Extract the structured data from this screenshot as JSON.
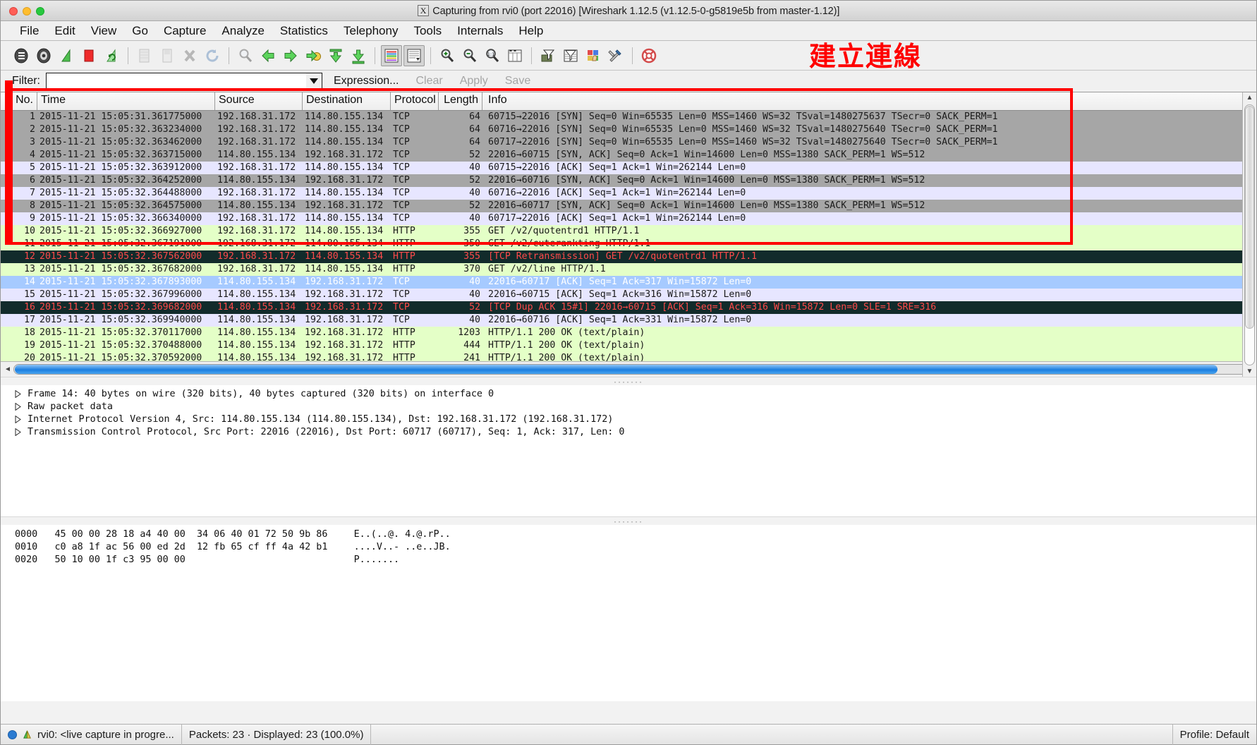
{
  "window": {
    "title_icon": "X",
    "title": "Capturing from rvi0 (port 22016)    [Wireshark 1.12.5  (v1.12.5-0-g5819e5b from master-1.12)]",
    "traffic_lights": [
      "close",
      "minimize",
      "zoom"
    ]
  },
  "menubar": {
    "items": [
      {
        "label": "File",
        "accel": "F"
      },
      {
        "label": "Edit",
        "accel": "E"
      },
      {
        "label": "View",
        "accel": "V"
      },
      {
        "label": "Go",
        "accel": "G"
      },
      {
        "label": "Capture",
        "accel": "C"
      },
      {
        "label": "Analyze",
        "accel": "A"
      },
      {
        "label": "Statistics",
        "accel": "S"
      },
      {
        "label": "Telephony",
        "accel": "y"
      },
      {
        "label": "Tools",
        "accel": "T"
      },
      {
        "label": "Internals",
        "accel": "I"
      },
      {
        "label": "Help",
        "accel": "H"
      }
    ]
  },
  "toolbar": {
    "buttons": [
      {
        "name": "interfaces-icon",
        "tip": "List the available capture interfaces"
      },
      {
        "name": "capture-options-icon",
        "tip": "Show the capture options"
      },
      {
        "name": "start-capture-icon",
        "tip": "Start a new live capture"
      },
      {
        "name": "stop-capture-icon",
        "tip": "Stop the running live capture"
      },
      {
        "name": "restart-capture-icon",
        "tip": "Restart the running live capture"
      },
      {
        "name": "open-file-icon",
        "tip": "Open a capture file"
      },
      {
        "name": "save-file-icon",
        "tip": "Save this capture file"
      },
      {
        "name": "close-file-icon",
        "tip": "Close this capture file"
      },
      {
        "name": "reload-file-icon",
        "tip": "Reload this capture file"
      },
      {
        "name": "find-packet-icon",
        "tip": "Find a packet"
      },
      {
        "name": "go-back-icon",
        "tip": "Go back in packet history"
      },
      {
        "name": "go-forward-icon",
        "tip": "Go forward in packet history"
      },
      {
        "name": "go-to-packet-icon",
        "tip": "Go to the packet with number"
      },
      {
        "name": "go-first-packet-icon",
        "tip": "Go to the first packet"
      },
      {
        "name": "go-last-packet-icon",
        "tip": "Go to the last packet"
      },
      {
        "name": "colorize-icon",
        "tip": "Colorize packet list"
      },
      {
        "name": "autoscroll-icon",
        "tip": "Auto scroll packet list in live capture"
      },
      {
        "name": "zoom-in-icon",
        "tip": "Zoom in"
      },
      {
        "name": "zoom-out-icon",
        "tip": "Zoom out"
      },
      {
        "name": "zoom-reset-icon",
        "tip": "Zoom 1:1"
      },
      {
        "name": "resize-columns-icon",
        "tip": "Resize columns"
      },
      {
        "name": "capture-filters-icon",
        "tip": "Edit capture filters"
      },
      {
        "name": "display-filters-icon",
        "tip": "Edit display filters"
      },
      {
        "name": "coloring-rules-icon",
        "tip": "Edit coloring rules"
      },
      {
        "name": "preferences-icon",
        "tip": "Edit preferences"
      },
      {
        "name": "help-icon",
        "tip": "Show help"
      }
    ]
  },
  "filter": {
    "label": "Filter:",
    "value": "",
    "placeholder": "",
    "expression_label": "Expression...",
    "clear_label": "Clear",
    "apply_label": "Apply",
    "save_label": "Save"
  },
  "annotation": {
    "text": "建立連線",
    "color": "#ff0000"
  },
  "packet_list": {
    "columns": [
      "No.",
      "Time",
      "Source",
      "Destination",
      "Protocol",
      "Length",
      "Info"
    ],
    "rows": [
      {
        "no": "1",
        "time": "2015-11-21 15:05:31.361775000",
        "src": "192.168.31.172",
        "dst": "114.80.155.134",
        "proto": "TCP",
        "len": "64",
        "info": "60715→22016 [SYN]  Seq=0 Win=65535 Len=0 MSS=1460 WS=32 TSval=1480275637 TSecr=0 SACK_PERM=1",
        "style": "r-tcp"
      },
      {
        "no": "2",
        "time": "2015-11-21 15:05:32.363234000",
        "src": "192.168.31.172",
        "dst": "114.80.155.134",
        "proto": "TCP",
        "len": "64",
        "info": "60716→22016 [SYN]  Seq=0 Win=65535 Len=0 MSS=1460 WS=32 TSval=1480275640 TSecr=0 SACK_PERM=1",
        "style": "r-tcp"
      },
      {
        "no": "3",
        "time": "2015-11-21 15:05:32.363462000",
        "src": "192.168.31.172",
        "dst": "114.80.155.134",
        "proto": "TCP",
        "len": "64",
        "info": "60717→22016 [SYN]  Seq=0 Win=65535 Len=0 MSS=1460 WS=32 TSval=1480275640 TSecr=0 SACK_PERM=1",
        "style": "r-tcp"
      },
      {
        "no": "4",
        "time": "2015-11-21 15:05:32.363715000",
        "src": "114.80.155.134",
        "dst": "192.168.31.172",
        "proto": "TCP",
        "len": "52",
        "info": "22016→60715 [SYN, ACK]  Seq=0 Ack=1 Win=14600 Len=0 MSS=1380 SACK_PERM=1 WS=512",
        "style": "r-tcp"
      },
      {
        "no": "5",
        "time": "2015-11-21 15:05:32.363912000",
        "src": "192.168.31.172",
        "dst": "114.80.155.134",
        "proto": "TCP",
        "len": "40",
        "info": "60715→22016 [ACK]  Seq=1 Ack=1 Win=262144 Len=0",
        "style": "r-ack"
      },
      {
        "no": "6",
        "time": "2015-11-21 15:05:32.364252000",
        "src": "114.80.155.134",
        "dst": "192.168.31.172",
        "proto": "TCP",
        "len": "52",
        "info": "22016→60716 [SYN, ACK]  Seq=0 Ack=1 Win=14600 Len=0 MSS=1380 SACK_PERM=1 WS=512",
        "style": "r-tcp"
      },
      {
        "no": "7",
        "time": "2015-11-21 15:05:32.364488000",
        "src": "192.168.31.172",
        "dst": "114.80.155.134",
        "proto": "TCP",
        "len": "40",
        "info": "60716→22016 [ACK]  Seq=1 Ack=1 Win=262144 Len=0",
        "style": "r-ack"
      },
      {
        "no": "8",
        "time": "2015-11-21 15:05:32.364575000",
        "src": "114.80.155.134",
        "dst": "192.168.31.172",
        "proto": "TCP",
        "len": "52",
        "info": "22016→60717 [SYN, ACK]  Seq=0 Ack=1 Win=14600 Len=0 MSS=1380 SACK_PERM=1 WS=512",
        "style": "r-tcp"
      },
      {
        "no": "9",
        "time": "2015-11-21 15:05:32.366340000",
        "src": "192.168.31.172",
        "dst": "114.80.155.134",
        "proto": "TCP",
        "len": "40",
        "info": "60717→22016 [ACK]  Seq=1 Ack=1 Win=262144 Len=0",
        "style": "r-ack"
      },
      {
        "no": "10",
        "time": "2015-11-21 15:05:32.366927000",
        "src": "192.168.31.172",
        "dst": "114.80.155.134",
        "proto": "HTTP",
        "len": "355",
        "info": "GET /v2/quotentrd1 HTTP/1.1",
        "style": "r-http"
      },
      {
        "no": "11",
        "time": "2015-11-21 15:05:32.367191000",
        "src": "192.168.31.172",
        "dst": "114.80.155.134",
        "proto": "HTTP",
        "len": "350",
        "info": "GET /v2/cuterankting HTTP/1.1",
        "style": "r-http"
      },
      {
        "no": "12",
        "time": "2015-11-21 15:05:32.367562000",
        "src": "192.168.31.172",
        "dst": "114.80.155.134",
        "proto": "HTTP",
        "len": "355",
        "info": "[TCP Retransmission] GET /v2/quotentrd1 HTTP/1.1",
        "style": "r-bad"
      },
      {
        "no": "13",
        "time": "2015-11-21 15:05:32.367682000",
        "src": "192.168.31.172",
        "dst": "114.80.155.134",
        "proto": "HTTP",
        "len": "370",
        "info": "GET /v2/line HTTP/1.1",
        "style": "r-http"
      },
      {
        "no": "14",
        "time": "2015-11-21 15:05:32.367893000",
        "src": "114.80.155.134",
        "dst": "192.168.31.172",
        "proto": "TCP",
        "len": "40",
        "info": "22016→60717 [ACK]  Seq=1 Ack=317 Win=15872 Len=0",
        "style": "r-selected"
      },
      {
        "no": "15",
        "time": "2015-11-21 15:05:32.367996000",
        "src": "114.80.155.134",
        "dst": "192.168.31.172",
        "proto": "TCP",
        "len": "40",
        "info": "22016→60715 [ACK]  Seq=1 Ack=316 Win=15872 Len=0",
        "style": "r-ack"
      },
      {
        "no": "16",
        "time": "2015-11-21 15:05:32.369682000",
        "src": "114.80.155.134",
        "dst": "192.168.31.172",
        "proto": "TCP",
        "len": "52",
        "info": "[TCP Dup ACK 15#1] 22016→60715 [ACK]  Seq=1 Ack=316 Win=15872 Len=0 SLE=1 SRE=316",
        "style": "r-bad"
      },
      {
        "no": "17",
        "time": "2015-11-21 15:05:32.369940000",
        "src": "114.80.155.134",
        "dst": "192.168.31.172",
        "proto": "TCP",
        "len": "40",
        "info": "22016→60716 [ACK]  Seq=1 Ack=331 Win=15872 Len=0",
        "style": "r-ack"
      },
      {
        "no": "18",
        "time": "2015-11-21 15:05:32.370117000",
        "src": "114.80.155.134",
        "dst": "192.168.31.172",
        "proto": "HTTP",
        "len": "1203",
        "info": "HTTP/1.1 200 OK  (text/plain)",
        "style": "r-http"
      },
      {
        "no": "19",
        "time": "2015-11-21 15:05:32.370488000",
        "src": "114.80.155.134",
        "dst": "192.168.31.172",
        "proto": "HTTP",
        "len": "444",
        "info": "HTTP/1.1 200 OK  (text/plain)",
        "style": "r-http"
      },
      {
        "no": "20",
        "time": "2015-11-21 15:05:32.370592000",
        "src": "114.80.155.134",
        "dst": "192.168.31.172",
        "proto": "HTTP",
        "len": "241",
        "info": "HTTP/1.1 200 OK  (text/plain)",
        "style": "r-http"
      }
    ]
  },
  "detail_tree": {
    "lines": [
      "Frame 14: 40 bytes on wire (320 bits), 40 bytes captured (320 bits) on interface 0",
      "Raw packet data",
      "Internet Protocol Version 4, Src: 114.80.155.134 (114.80.155.134), Dst: 192.168.31.172 (192.168.31.172)",
      "Transmission Control Protocol, Src Port: 22016 (22016), Dst Port: 60717 (60717), Seq: 1, Ack: 317, Len: 0"
    ]
  },
  "hex_dump": {
    "lines": [
      {
        "offset": "0000",
        "bytes": "45 00 00 28 18 a4 40 00  34 06 40 01 72 50 9b 86",
        "ascii": "E..(..@. 4.@.rP.."
      },
      {
        "offset": "0010",
        "bytes": "c0 a8 1f ac 56 00 ed 2d  12 fb 65 cf ff 4a 42 b1",
        "ascii": "....V..- ..e..JB."
      },
      {
        "offset": "0020",
        "bytes": "50 10 00 1f c3 95 00 00",
        "ascii": "P......."
      }
    ]
  },
  "statusbar": {
    "capture_text": "rvi0: <live capture in progre...",
    "packets_text": "Packets: 23 · Displayed: 23 (100.0%)",
    "profile_text": "Profile: Default"
  }
}
